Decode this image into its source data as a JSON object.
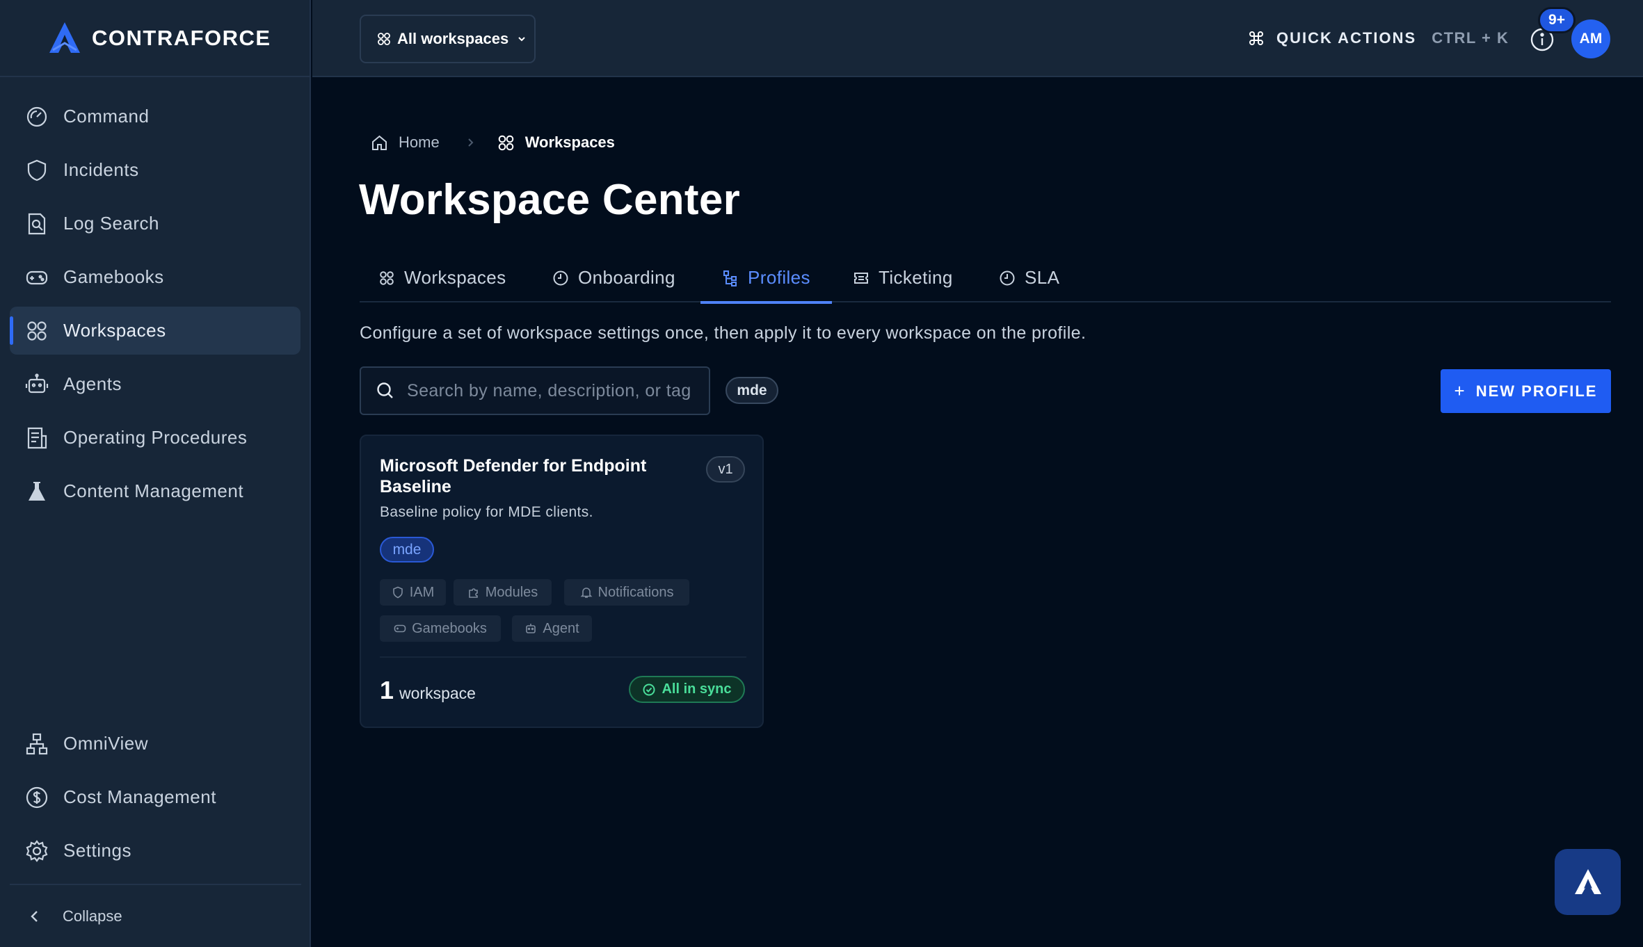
{
  "brand": {
    "name": "CONTRAFORCE"
  },
  "sidebar": {
    "items": [
      {
        "label": "Command",
        "icon": "gauge-icon"
      },
      {
        "label": "Incidents",
        "icon": "shield-icon"
      },
      {
        "label": "Log Search",
        "icon": "log-search-icon"
      },
      {
        "label": "Gamebooks",
        "icon": "gamepad-icon"
      },
      {
        "label": "Workspaces",
        "icon": "grid-icon",
        "active": true
      },
      {
        "label": "Agents",
        "icon": "robot-icon"
      },
      {
        "label": "Operating Procedures",
        "icon": "document-list-icon"
      },
      {
        "label": "Content Management",
        "icon": "flask-icon"
      }
    ],
    "bottom_items": [
      {
        "label": "OmniView",
        "icon": "hierarchy-icon"
      },
      {
        "label": "Cost Management",
        "icon": "dollar-icon"
      },
      {
        "label": "Settings",
        "icon": "gear-icon"
      }
    ],
    "collapse_label": "Collapse"
  },
  "topbar": {
    "workspace_select": "All workspaces",
    "quick_actions_label": "QUICK ACTIONS",
    "quick_actions_shortcut": "CTRL + K",
    "notification_badge": "9+",
    "avatar_initials": "AM"
  },
  "breadcrumb": {
    "home": "Home",
    "current": "Workspaces"
  },
  "page": {
    "title": "Workspace Center",
    "description": "Configure a set of workspace settings once, then apply it to every workspace on the profile."
  },
  "tabs": [
    {
      "label": "Workspaces",
      "icon": "grid-icon"
    },
    {
      "label": "Onboarding",
      "icon": "clock-icon"
    },
    {
      "label": "Profiles",
      "icon": "tree-icon",
      "active": true
    },
    {
      "label": "Ticketing",
      "icon": "ticket-icon"
    },
    {
      "label": "SLA",
      "icon": "clock-icon"
    }
  ],
  "search": {
    "placeholder": "Search by name, description, or tag",
    "value": ""
  },
  "filter_chip": "mde",
  "new_profile_label": "NEW PROFILE",
  "profile_card": {
    "title": "Microsoft Defender for Endpoint Baseline",
    "version": "v1",
    "description": "Baseline policy for MDE clients.",
    "tag": "mde",
    "features": [
      "IAM",
      "Modules",
      "Notifications",
      "Gamebooks",
      "Agent"
    ],
    "workspace_count": "1",
    "workspace_unit": "workspace",
    "sync_status": "All in sync"
  },
  "colors": {
    "accent": "#1f5cf2",
    "active_tab": "#5b8dff",
    "sync_green": "#4ade9a",
    "sidebar_bg": "#172638",
    "main_bg": "#020d1c"
  }
}
